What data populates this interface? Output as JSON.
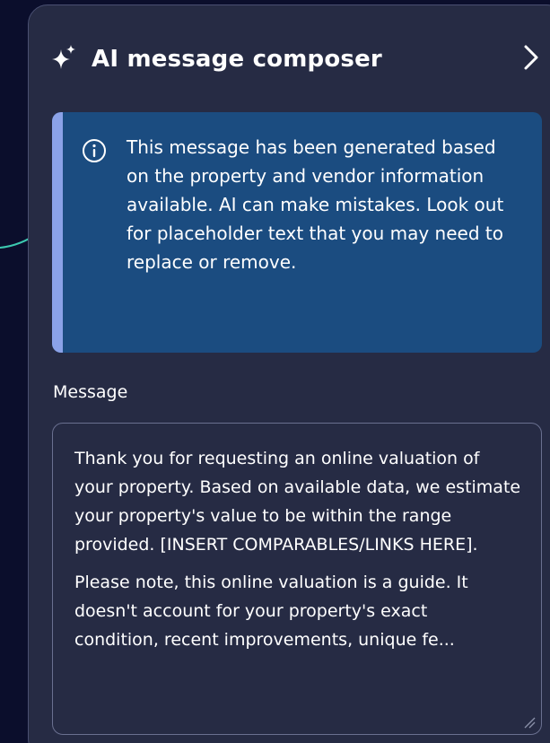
{
  "panel": {
    "title": "AI message composer",
    "icons": {
      "title_icon": "sparkle-icon",
      "collapse_icon": "chevron-right-icon",
      "info_icon": "info-circle-icon",
      "pointer": "curved-arrow-icon",
      "resize": "resize-handle-icon"
    }
  },
  "info_banner": {
    "text": "This message has been generated based on the property and vendor information available. AI can make mistakes. Look out for placeholder text that you may need to replace or remove."
  },
  "message": {
    "label": "Message",
    "paragraph_1": "Thank you for requesting an online valuation of your property. Based on available data, we estimate your property's value to be within the range provided. [INSERT COMPARABLES/LINKS HERE].",
    "paragraph_2_visible": "Please note, this online valuation is a guide. It doesn't account for your property's exact",
    "paragraph_2_truncated": "condition, recent improvements, unique fe..."
  },
  "colors": {
    "page_background": "#0b0e2c",
    "panel_background": "#262b44",
    "info_background": "#1b4c80",
    "info_accent": "#8ba2e8",
    "arrow": "#3cc9b0",
    "text": "#ffffff"
  }
}
